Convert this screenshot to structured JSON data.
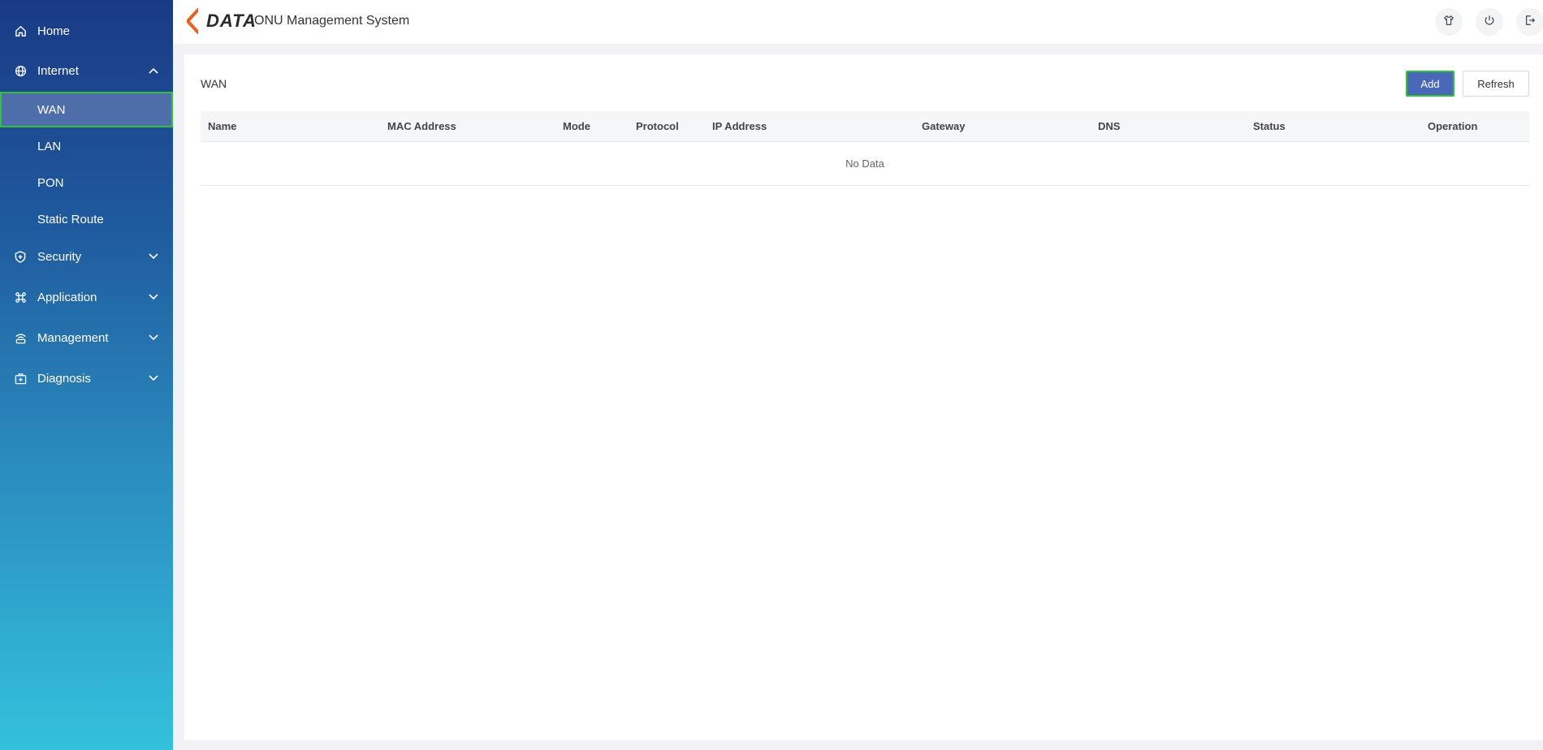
{
  "app": {
    "logo_text": "DATA",
    "title": "ONU Management System"
  },
  "sidebar": {
    "items": [
      {
        "label": "Home",
        "icon": "home-icon"
      },
      {
        "label": "Internet",
        "icon": "globe-icon",
        "expanded": true,
        "children": [
          {
            "label": "WAN",
            "active": true
          },
          {
            "label": "LAN"
          },
          {
            "label": "PON"
          },
          {
            "label": "Static Route"
          }
        ]
      },
      {
        "label": "Security",
        "icon": "shield-icon",
        "expanded": false
      },
      {
        "label": "Application",
        "icon": "command-icon",
        "expanded": false
      },
      {
        "label": "Management",
        "icon": "management-icon",
        "expanded": false
      },
      {
        "label": "Diagnosis",
        "icon": "medkit-icon",
        "expanded": false
      }
    ]
  },
  "topbar": {
    "buttons": [
      "theme-shirt-icon",
      "power-icon",
      "logout-icon"
    ]
  },
  "page": {
    "title": "WAN",
    "add_label": "Add",
    "refresh_label": "Refresh"
  },
  "table": {
    "columns": [
      "Name",
      "MAC Address",
      "Mode",
      "Protocol",
      "IP Address",
      "Gateway",
      "DNS",
      "Status",
      "Operation"
    ],
    "rows": [],
    "empty_text": "No Data"
  },
  "colors": {
    "sidebar_top": "#1a3a85",
    "sidebar_bottom": "#33c1dd",
    "primary": "#4a68b8",
    "highlight_border": "#34c13a"
  }
}
